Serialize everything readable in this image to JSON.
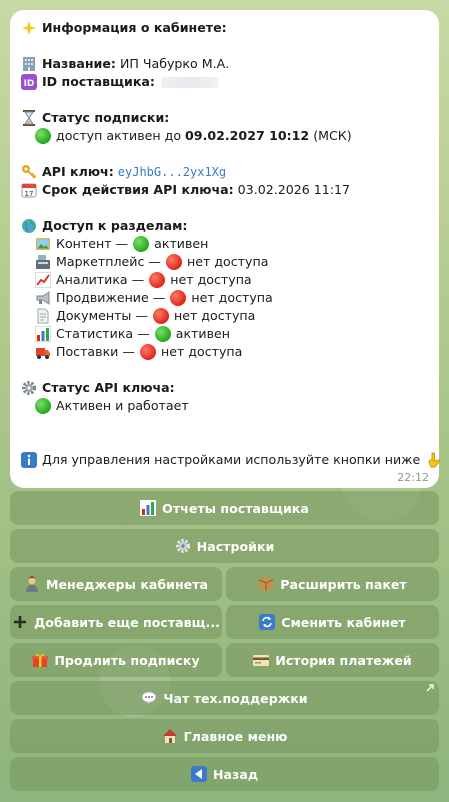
{
  "message": {
    "header": "Информация о кабинете:",
    "name_label": "Название:",
    "name_value": "ИП Чабурко М.А.",
    "id_label": "ID поставщика:",
    "sub_label": "Статус подписки:",
    "sub_text": "доступ активен до",
    "sub_date": "09.02.2027 10:12",
    "sub_tz": "(МСК)",
    "api_label": "API ключ:",
    "api_value": "eyJhbG...2yx1Xg",
    "api_exp_label": "Срок действия API ключа:",
    "api_exp_value": "03.02.2026 11:17",
    "access_label": "Доступ к разделам:",
    "sections": [
      {
        "name": "Контент —",
        "status": "активен"
      },
      {
        "name": "Маркетплейс —",
        "status": "нет доступа"
      },
      {
        "name": "Аналитика —",
        "status": "нет доступа"
      },
      {
        "name": "Продвижение —",
        "status": "нет доступа"
      },
      {
        "name": "Документы —",
        "status": "нет доступа"
      },
      {
        "name": "Статистика —",
        "status": "активен"
      },
      {
        "name": "Поставки —",
        "status": "нет доступа"
      }
    ],
    "api_status_label": "Статус API ключа:",
    "api_status_value": "Активен и работает",
    "footer": "Для управления настройками используйте кнопки ниже",
    "time": "22:12"
  },
  "buttons": {
    "reports": "Отчеты поставщика",
    "settings": "Настройки",
    "managers": "Менеджеры кабинета",
    "expand": "Расширить пакет",
    "add_supplier": "Добавить еще поставщ...",
    "switch_cabinet": "Сменить кабинет",
    "extend": "Продлить подписку",
    "payments": "История платежей",
    "support": "Чат тех.поддержки",
    "main_menu": "Главное меню",
    "back": "Назад"
  },
  "colors": {
    "active": "#22a81b",
    "inactive": "#e0261b",
    "link": "#3a7bc8",
    "button_bg": "#7c9a60"
  }
}
